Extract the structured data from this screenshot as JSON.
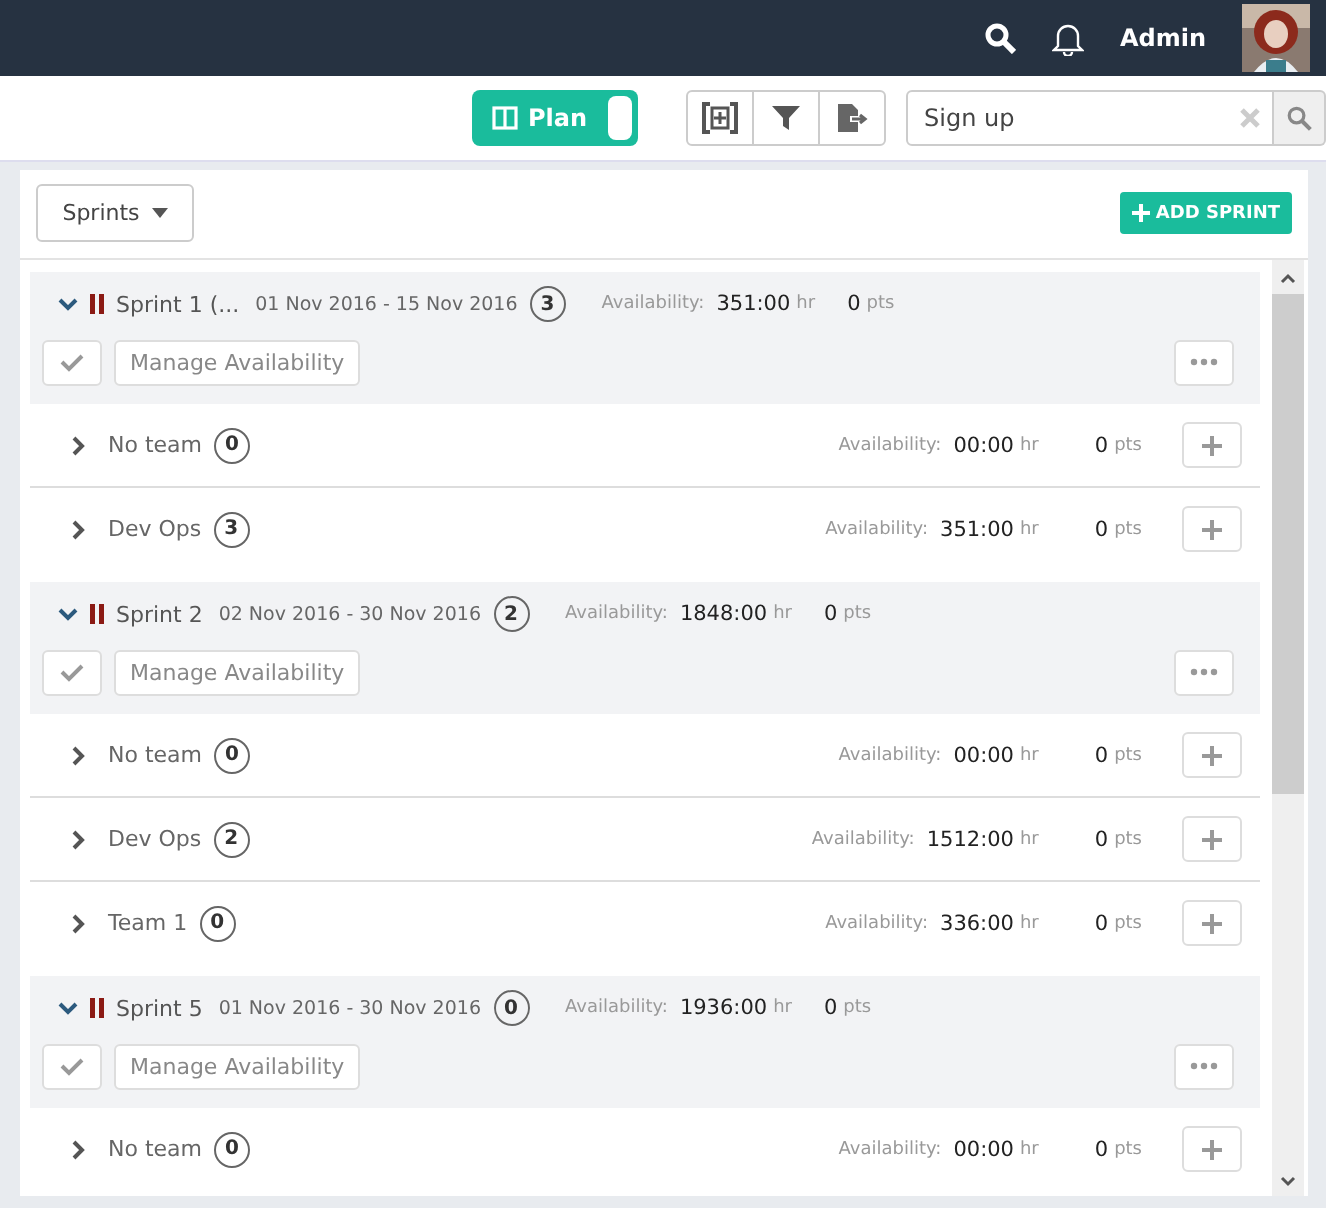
{
  "top_bar": {
    "user": "Admin"
  },
  "toolbar": {
    "plan_toggle": {
      "label": "Plan",
      "on": true
    },
    "search": {
      "value": "Sign up"
    }
  },
  "panel": {
    "filter_button": "Sprints",
    "add_button": "ADD SPRINT",
    "sprints": [
      {
        "name": "Sprint 1 (...",
        "dates": "01 Nov 2016 - 15 Nov 2016",
        "count": "3",
        "availability_label": "Availability:",
        "availability": "351:00",
        "hr": "hr",
        "points": "0",
        "pts": "pts",
        "expanded": true,
        "manage_label": "Manage Availability",
        "teams": [
          {
            "name": "No team",
            "count": "0",
            "availability_label": "Availability:",
            "availability": "00:00",
            "hr": "hr",
            "points": "0",
            "pts": "pts",
            "expanded": false
          },
          {
            "name": "Dev Ops",
            "count": "3",
            "availability_label": "Availability:",
            "availability": "351:00",
            "hr": "hr",
            "points": "0",
            "pts": "pts",
            "expanded": false
          }
        ]
      },
      {
        "name": "Sprint 2",
        "dates": "02 Nov 2016 - 30 Nov 2016",
        "count": "2",
        "availability_label": "Availability:",
        "availability": "1848:00",
        "hr": "hr",
        "points": "0",
        "pts": "pts",
        "expanded": true,
        "manage_label": "Manage Availability",
        "teams": [
          {
            "name": "No team",
            "count": "0",
            "availability_label": "Availability:",
            "availability": "00:00",
            "hr": "hr",
            "points": "0",
            "pts": "pts",
            "expanded": false
          },
          {
            "name": "Dev Ops",
            "count": "2",
            "availability_label": "Availability:",
            "availability": "1512:00",
            "hr": "hr",
            "points": "0",
            "pts": "pts",
            "expanded": false
          },
          {
            "name": "Team 1",
            "count": "0",
            "availability_label": "Availability:",
            "availability": "336:00",
            "hr": "hr",
            "points": "0",
            "pts": "pts",
            "expanded": false
          }
        ]
      },
      {
        "name": "Sprint 5",
        "dates": "01 Nov 2016 - 30 Nov 2016",
        "count": "0",
        "availability_label": "Availability:",
        "availability": "1936:00",
        "hr": "hr",
        "points": "0",
        "pts": "pts",
        "expanded": true,
        "manage_label": "Manage Availability",
        "teams": [
          {
            "name": "No team",
            "count": "0",
            "availability_label": "Availability:",
            "availability": "00:00",
            "hr": "hr",
            "points": "0",
            "pts": "pts",
            "expanded": false
          }
        ]
      }
    ]
  }
}
